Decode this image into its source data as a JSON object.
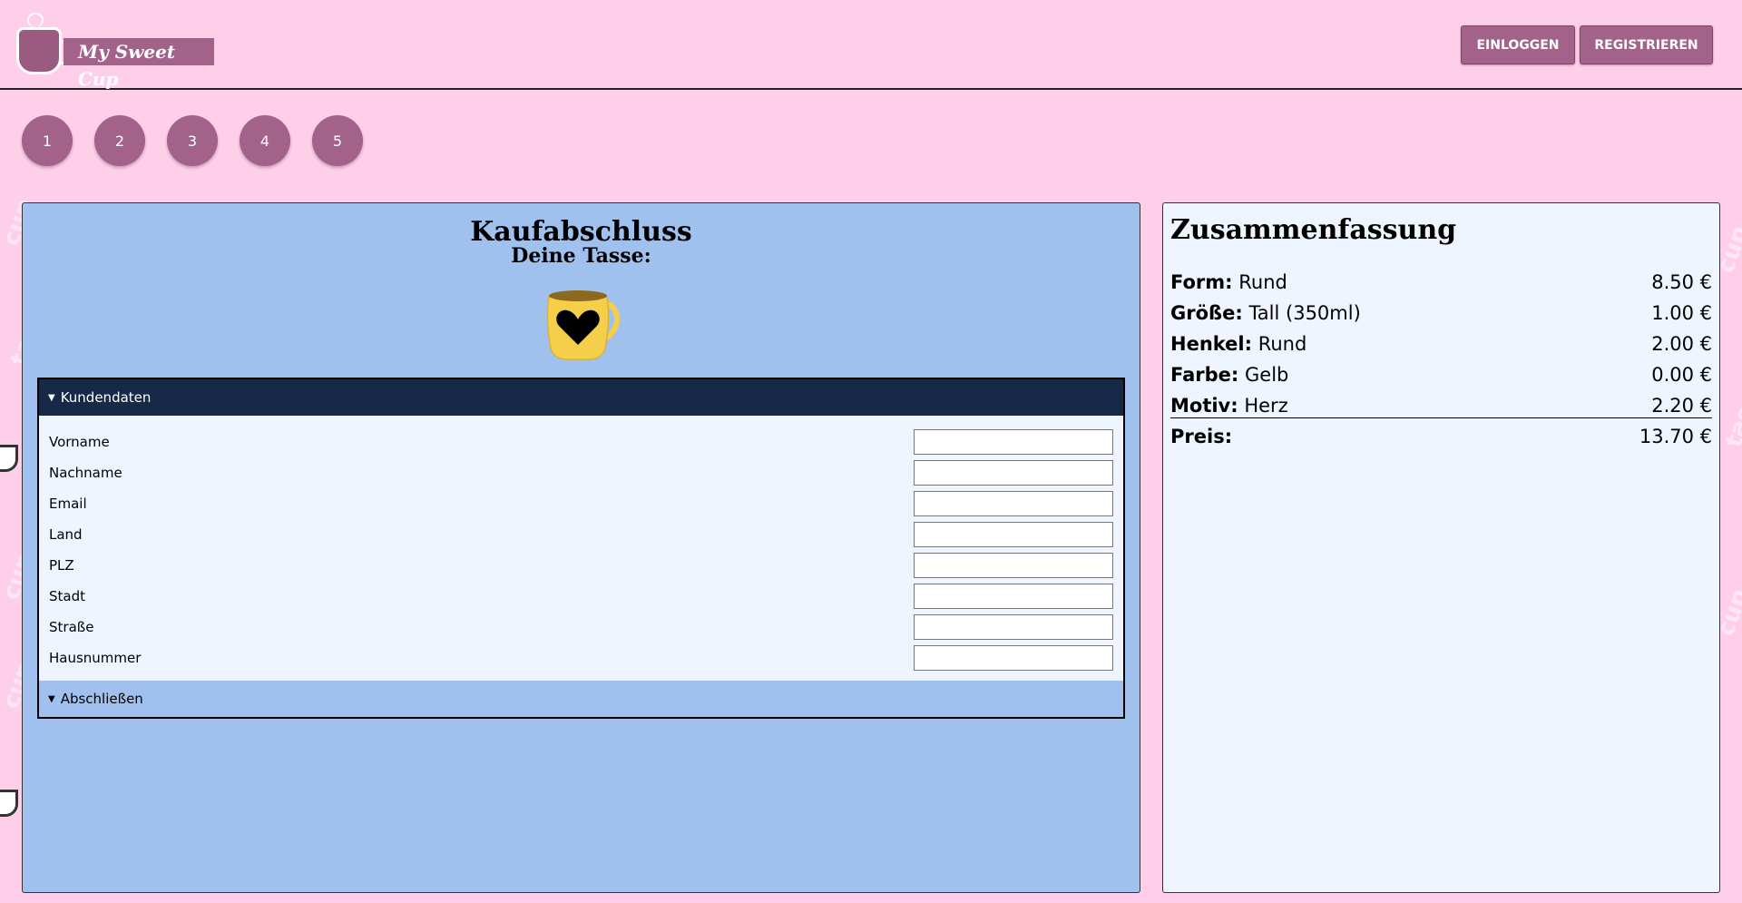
{
  "header": {
    "logo_text": "My Sweet Cup",
    "login_label": "Einloggen",
    "register_label": "Registrieren"
  },
  "steps": [
    "1",
    "2",
    "3",
    "4",
    "5"
  ],
  "main": {
    "title": "Kaufabschluss",
    "subtitle": "Deine Tasse:",
    "mug": {
      "color": "#f5cf4a",
      "motif": "heart-icon"
    },
    "customer_section": {
      "label": "Kundendaten",
      "fields": [
        {
          "label": "Vorname",
          "value": ""
        },
        {
          "label": "Nachname",
          "value": ""
        },
        {
          "label": "Email",
          "value": ""
        },
        {
          "label": "Land",
          "value": ""
        },
        {
          "label": "PLZ",
          "value": ""
        },
        {
          "label": "Stadt",
          "value": ""
        },
        {
          "label": "Straße",
          "value": ""
        },
        {
          "label": "Hausnummer",
          "value": ""
        }
      ]
    },
    "finish_section": {
      "label": "Abschließen"
    }
  },
  "summary": {
    "title": "Zusammenfassung",
    "items": [
      {
        "key": "Form:",
        "value": "Rund",
        "price": "8.50 €"
      },
      {
        "key": "Größe:",
        "value": "Tall (350ml)",
        "price": "1.00 €"
      },
      {
        "key": "Henkel:",
        "value": "Rund",
        "price": "2.00 €"
      },
      {
        "key": "Farbe:",
        "value": "Gelb",
        "price": "0.00 €"
      },
      {
        "key": "Motiv:",
        "value": "Herz",
        "price": "2.20 €"
      }
    ],
    "total_label": "Preis:",
    "total_price": "13.70 €"
  },
  "colors": {
    "background": "#ffcfe9",
    "accent": "#a3628a",
    "panel": "#a0c1ee",
    "section_head": "#162a48"
  }
}
